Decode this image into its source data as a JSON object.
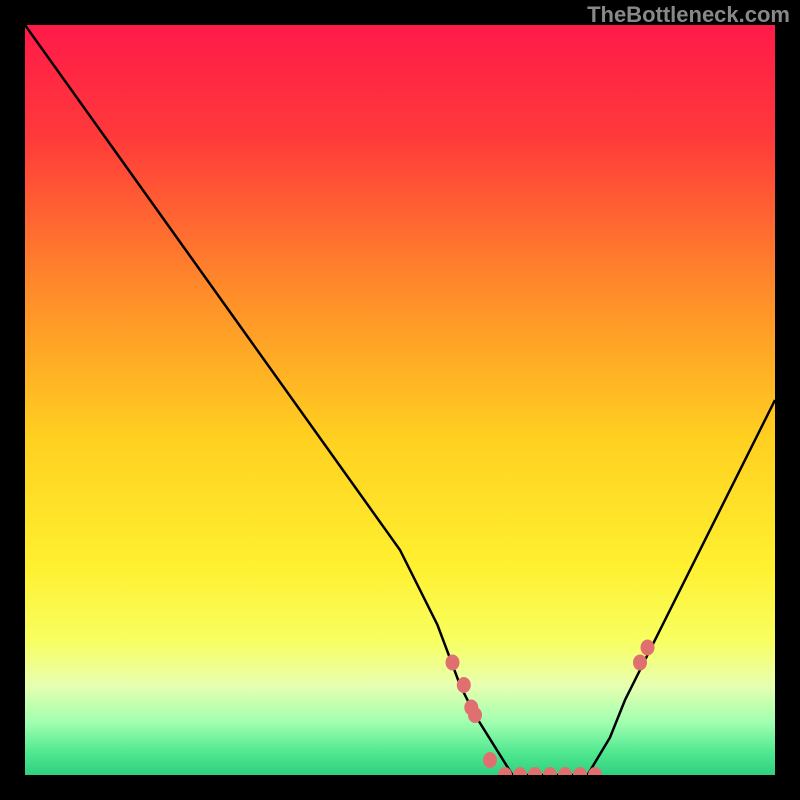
{
  "branding": {
    "text": "TheBottleneck.com"
  },
  "chart_data": {
    "type": "line",
    "title": "",
    "xlabel": "",
    "ylabel": "",
    "xlim": [
      0,
      100
    ],
    "ylim": [
      0,
      100
    ],
    "series": [
      {
        "name": "bottleneck-curve",
        "x": [
          0,
          10,
          20,
          30,
          40,
          50,
          55,
          58,
          60,
          65,
          70,
          75,
          78,
          80,
          85,
          100
        ],
        "values": [
          100,
          86,
          72,
          58,
          44,
          30,
          20,
          12,
          8,
          0,
          0,
          0,
          5,
          10,
          20,
          50
        ]
      }
    ],
    "markers": {
      "name": "highlight-points",
      "x": [
        57,
        58.5,
        59.5,
        60,
        62,
        64,
        66,
        68,
        70,
        72,
        74,
        76,
        82,
        83
      ],
      "values": [
        15,
        12,
        9,
        8,
        2,
        0,
        0,
        0,
        0,
        0,
        0,
        0,
        15,
        17
      ]
    },
    "gradient_stops": [
      {
        "offset": 0.0,
        "color": "#ff1a4a"
      },
      {
        "offset": 0.15,
        "color": "#ff3a3a"
      },
      {
        "offset": 0.35,
        "color": "#ff8a2a"
      },
      {
        "offset": 0.55,
        "color": "#ffd020"
      },
      {
        "offset": 0.72,
        "color": "#fff030"
      },
      {
        "offset": 0.82,
        "color": "#f8ff60"
      },
      {
        "offset": 0.88,
        "color": "#e8ffb0"
      },
      {
        "offset": 0.93,
        "color": "#a0ffb0"
      },
      {
        "offset": 0.97,
        "color": "#50e890"
      },
      {
        "offset": 1.0,
        "color": "#30d080"
      }
    ],
    "marker_color": "#e07070",
    "line_color": "#000000"
  }
}
